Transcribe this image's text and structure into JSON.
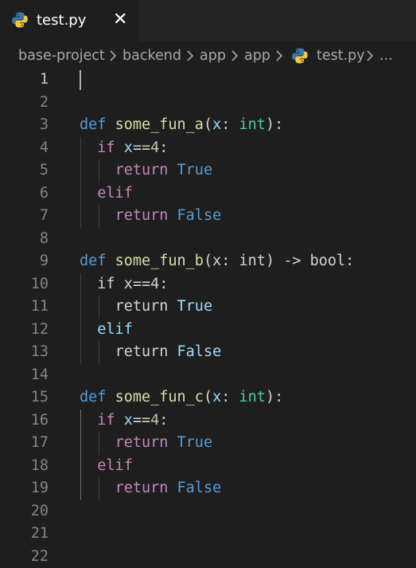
{
  "colors": {
    "editor_bg": "#1e1e1e",
    "tabbar_bg": "#252526",
    "keyword_def": "#569cd6",
    "keyword_control": "#c586c0",
    "function_name": "#dcdcaa",
    "parameter": "#9cdcfe",
    "type": "#4ec9b0",
    "number": "#b5cea8",
    "line_number": "#858585"
  },
  "tab": {
    "label": "test.py",
    "icon": "python-icon",
    "close_icon": "close-icon",
    "close_glyph": "✕"
  },
  "breadcrumb": {
    "items": [
      "base-project",
      "backend",
      "app",
      "app",
      "test.py"
    ],
    "file_icon": "python-icon",
    "ellipsis": "..."
  },
  "editor": {
    "cursor_line": 1,
    "lines": [
      {
        "n": "1",
        "tokens": []
      },
      {
        "n": "2",
        "tokens": []
      },
      {
        "n": "3",
        "tokens": [
          [
            "def",
            "k-def"
          ],
          [
            " ",
            "plain"
          ],
          [
            "some_fun_a",
            "fn"
          ],
          [
            "(",
            "plain"
          ],
          [
            "x",
            "param"
          ],
          [
            ": ",
            "plain"
          ],
          [
            "int",
            "typ"
          ],
          [
            "):",
            "plain"
          ]
        ]
      },
      {
        "n": "4",
        "tokens": [
          [
            "  ",
            "plain"
          ],
          [
            "if",
            "k-ctl"
          ],
          [
            " ",
            "plain"
          ],
          [
            "x",
            "param"
          ],
          [
            "==",
            "plain"
          ],
          [
            "4",
            "num"
          ],
          [
            ":",
            "plain"
          ]
        ]
      },
      {
        "n": "5",
        "tokens": [
          [
            "    ",
            "plain"
          ],
          [
            "return",
            "k-ctl"
          ],
          [
            " ",
            "plain"
          ],
          [
            "True",
            "lit"
          ]
        ]
      },
      {
        "n": "6",
        "tokens": [
          [
            "  ",
            "plain"
          ],
          [
            "elif",
            "k-ctl"
          ]
        ]
      },
      {
        "n": "7",
        "tokens": [
          [
            "    ",
            "plain"
          ],
          [
            "return",
            "k-ctl"
          ],
          [
            " ",
            "plain"
          ],
          [
            "False",
            "lit"
          ]
        ]
      },
      {
        "n": "8",
        "tokens": []
      },
      {
        "n": "9",
        "tokens": [
          [
            "def",
            "k-def"
          ],
          [
            " ",
            "plain"
          ],
          [
            "some_fun_b",
            "fn"
          ],
          [
            "(x: ",
            "plain"
          ],
          [
            "int",
            "plain"
          ],
          [
            ") -> bool:",
            "plain"
          ]
        ]
      },
      {
        "n": "10",
        "tokens": [
          [
            "  ",
            "plain"
          ],
          [
            "if",
            "k-ctlw"
          ],
          [
            " x==4:",
            "plain"
          ]
        ]
      },
      {
        "n": "11",
        "tokens": [
          [
            "    ",
            "plain"
          ],
          [
            "return",
            "k-ctlw"
          ],
          [
            " ",
            "plain"
          ],
          [
            "True",
            "param"
          ]
        ]
      },
      {
        "n": "12",
        "tokens": [
          [
            "  ",
            "plain"
          ],
          [
            "elif",
            "param"
          ]
        ]
      },
      {
        "n": "13",
        "tokens": [
          [
            "    ",
            "plain"
          ],
          [
            "return",
            "k-ctlw"
          ],
          [
            " ",
            "plain"
          ],
          [
            "False",
            "param"
          ]
        ]
      },
      {
        "n": "14",
        "tokens": []
      },
      {
        "n": "15",
        "tokens": [
          [
            "def",
            "k-def"
          ],
          [
            " ",
            "plain"
          ],
          [
            "some_fun_c",
            "fn"
          ],
          [
            "(",
            "plain"
          ],
          [
            "x",
            "param"
          ],
          [
            ": ",
            "plain"
          ],
          [
            "int",
            "typ"
          ],
          [
            "):",
            "plain"
          ]
        ]
      },
      {
        "n": "16",
        "tokens": [
          [
            "  ",
            "plain"
          ],
          [
            "if",
            "k-ctl"
          ],
          [
            " ",
            "plain"
          ],
          [
            "x",
            "param"
          ],
          [
            "==",
            "plain"
          ],
          [
            "4",
            "num"
          ],
          [
            ":",
            "plain"
          ]
        ]
      },
      {
        "n": "17",
        "tokens": [
          [
            "    ",
            "plain"
          ],
          [
            "return",
            "k-ctl"
          ],
          [
            " ",
            "plain"
          ],
          [
            "True",
            "lit"
          ]
        ]
      },
      {
        "n": "18",
        "tokens": [
          [
            "  ",
            "plain"
          ],
          [
            "elif",
            "k-ctl"
          ]
        ]
      },
      {
        "n": "19",
        "tokens": [
          [
            "    ",
            "plain"
          ],
          [
            "return",
            "k-ctl"
          ],
          [
            " ",
            "plain"
          ],
          [
            "False",
            "lit"
          ]
        ]
      },
      {
        "n": "20",
        "tokens": []
      },
      {
        "n": "21",
        "tokens": []
      },
      {
        "n": "22",
        "tokens": []
      }
    ]
  }
}
